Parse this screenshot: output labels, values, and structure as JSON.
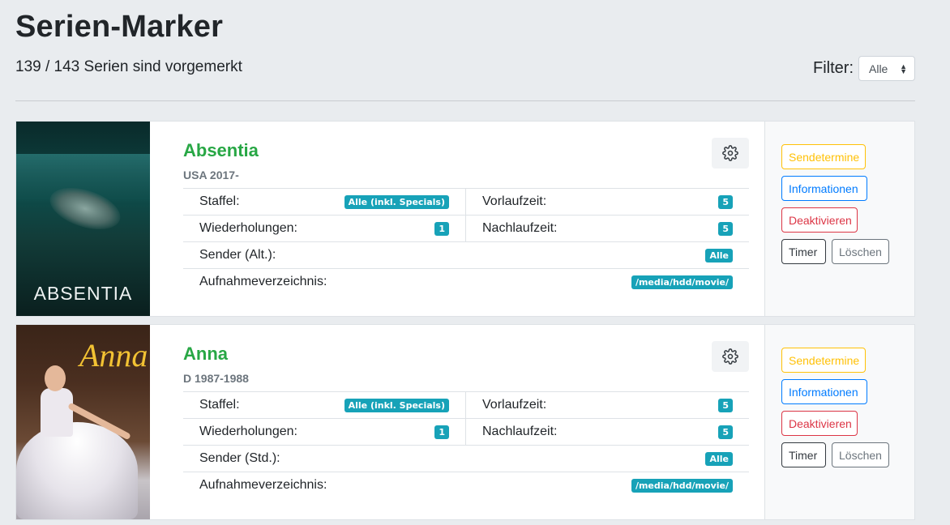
{
  "page": {
    "title": "Serien-Marker",
    "count_text": "139 / 143 Serien sind vorgemerkt",
    "filter_label": "Filter:",
    "filter_value": "Alle"
  },
  "series": [
    {
      "poster_text": "ABSENTIA",
      "title": "Absentia",
      "meta": "USA 2017-",
      "staffel_label": "Staffel:",
      "staffel_value": "Alle (inkl. Specials)",
      "vorlauf_label": "Vorlaufzeit:",
      "vorlauf_value": "5",
      "wiederholungen_label": "Wiederholungen:",
      "wiederholungen_value": "1",
      "nachlauf_label": "Nachlaufzeit:",
      "nachlauf_value": "5",
      "sender_label": "Sender (Alt.):",
      "sender_value": "Alle",
      "verzeichnis_label": "Aufnahmeverzeichnis:",
      "verzeichnis_value": "/media/hdd/movie/",
      "actions": {
        "sendetermine": "Sendetermine",
        "informationen": "Informationen",
        "deaktivieren": "Deaktivieren",
        "timer": "Timer",
        "loeschen": "Löschen"
      }
    },
    {
      "poster_text": "Anna",
      "title": "Anna",
      "meta": "D 1987-1988",
      "staffel_label": "Staffel:",
      "staffel_value": "Alle (inkl. Specials)",
      "vorlauf_label": "Vorlaufzeit:",
      "vorlauf_value": "5",
      "wiederholungen_label": "Wiederholungen:",
      "wiederholungen_value": "1",
      "nachlauf_label": "Nachlaufzeit:",
      "nachlauf_value": "5",
      "sender_label": "Sender (Std.):",
      "sender_value": "Alle",
      "verzeichnis_label": "Aufnahmeverzeichnis:",
      "verzeichnis_value": "/media/hdd/movie/",
      "actions": {
        "sendetermine": "Sendetermine",
        "informationen": "Informationen",
        "deaktivieren": "Deaktivieren",
        "timer": "Timer",
        "loeschen": "Löschen"
      }
    }
  ],
  "colors": {
    "title_green": "#28a745",
    "badge_teal": "#17a2b8",
    "warning": "#ffc107",
    "primary": "#007bff",
    "danger": "#dc3545",
    "dark": "#343a40",
    "secondary": "#6c757d"
  },
  "icons": {
    "settings": "gear-icon",
    "filter_arrows": "sort-arrows-icon"
  }
}
